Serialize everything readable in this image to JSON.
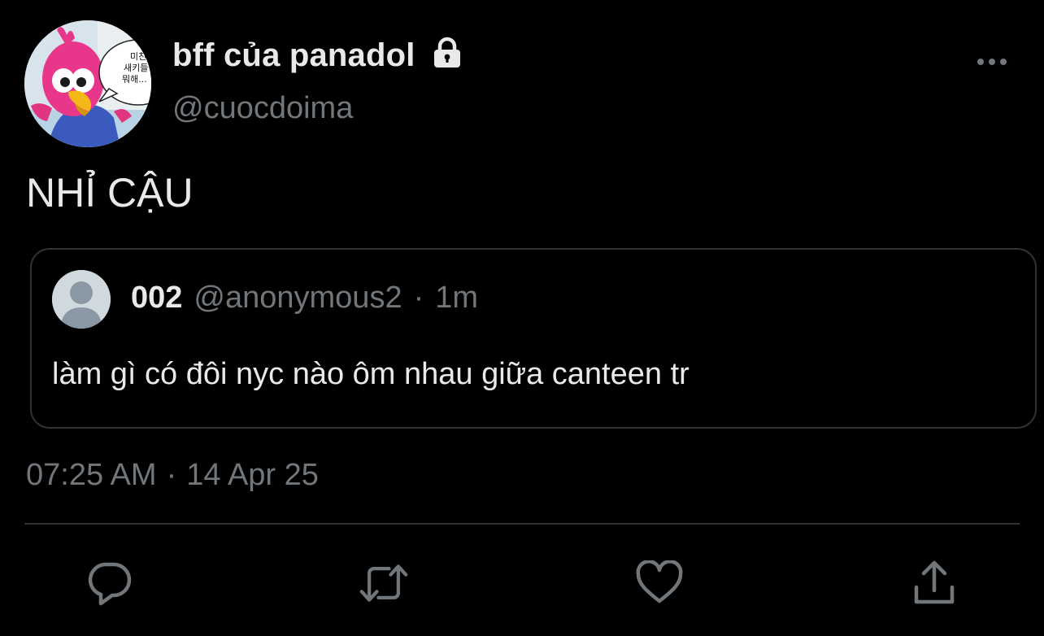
{
  "author": {
    "display_name": "bff của panadol",
    "handle": "@cuocdoima",
    "avatar_icon": "cartoon-bird-avatar",
    "avatar_speech_bubble": [
      "미친 자",
      "새키들",
      "뭐해..."
    ],
    "protected_icon": "lock-icon"
  },
  "tweet": {
    "text": "NHỈ CẬU",
    "time": "07:25 AM",
    "separator": "·",
    "date": "14 Apr 25"
  },
  "quoted_tweet": {
    "name": "002",
    "handle": "@anonymous2",
    "separator": "·",
    "time": "1m",
    "text": "làm gì có đôi nyc nào ôm nhau giữa canteen tr",
    "avatar_icon": "default-user-avatar"
  },
  "actions": {
    "reply_icon": "reply-icon",
    "retweet_icon": "retweet-icon",
    "like_icon": "heart-icon",
    "share_icon": "share-icon",
    "more_icon": "more-icon"
  },
  "colors": {
    "background": "#000000",
    "text_primary": "#e7e9ea",
    "text_secondary": "#71767b",
    "border": "#2f3336"
  }
}
